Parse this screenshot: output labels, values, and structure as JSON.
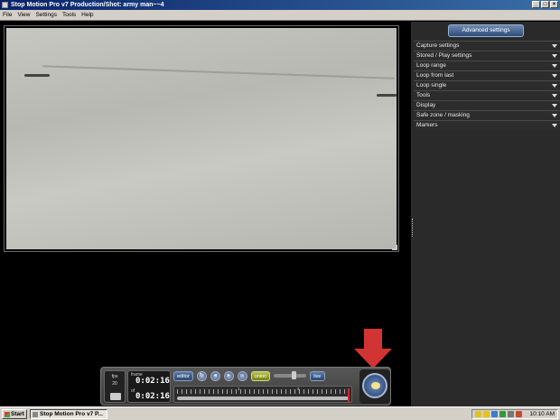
{
  "window": {
    "title": "Stop Motion Pro v7  Production/Shot: army man~~4",
    "buttons": {
      "minimize": "_",
      "maximize": "□",
      "close": "×"
    }
  },
  "menu": {
    "items": [
      "File",
      "View",
      "Settings",
      "Tools",
      "Help"
    ]
  },
  "right_panel": {
    "advanced_button": "Advanced settings",
    "sections": [
      "Capture settings",
      "Stored / Play settings",
      "Loop range",
      "Loop from last",
      "Loop single",
      "Tools",
      "Display",
      "Safe zone / masking",
      "Markers"
    ]
  },
  "transport": {
    "fps_label": "fps",
    "fps_value": "20",
    "frame_label": "frame",
    "frame_time": "0:02:16",
    "of_label": "of",
    "total_time": "0:02:16",
    "editor_label": "editor",
    "overlay_label": "onion",
    "live_label": "live",
    "timeline_labels": [
      "1",
      "2"
    ],
    "capture_icon": "camera-capture-icon"
  },
  "annotation": {
    "color": "#d23434"
  },
  "taskbar": {
    "start_label": "Start",
    "task_label": "Stop Motion Pro v7   P...",
    "clock": "10:10 AM"
  }
}
